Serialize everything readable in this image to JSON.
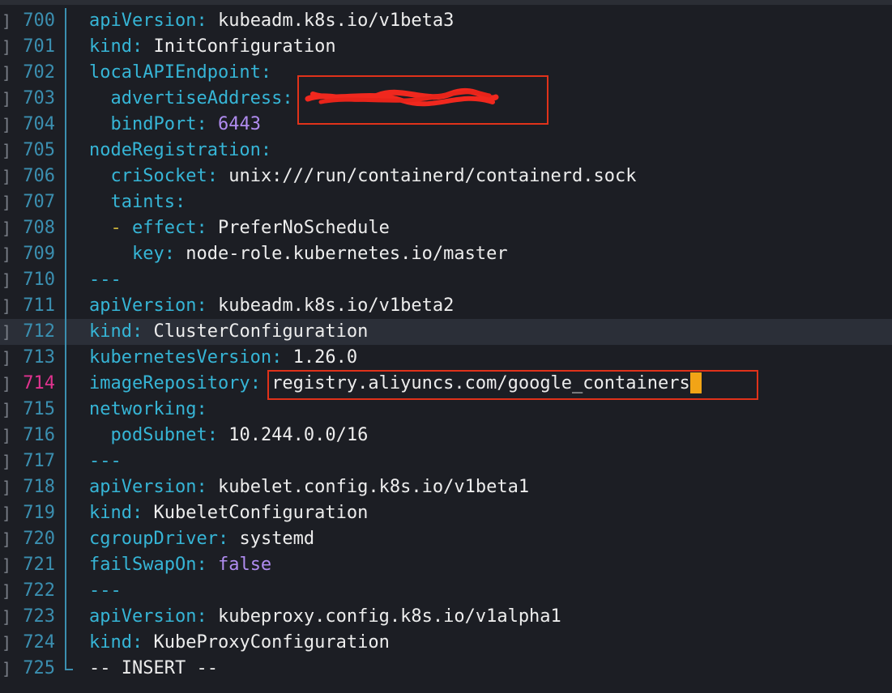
{
  "editor": {
    "mode_status": "-- INSERT --",
    "lines": [
      {
        "num": "700",
        "segments": [
          {
            "t": "apiVersion",
            "c": "key"
          },
          {
            "t": ": ",
            "c": "sep"
          },
          {
            "t": "kubeadm.k8s.io/v1beta3",
            "c": "val"
          }
        ]
      },
      {
        "num": "701",
        "segments": [
          {
            "t": "kind",
            "c": "key"
          },
          {
            "t": ": ",
            "c": "sep"
          },
          {
            "t": "InitConfiguration",
            "c": "val"
          }
        ]
      },
      {
        "num": "702",
        "segments": [
          {
            "t": "localAPIEndpoint",
            "c": "key"
          },
          {
            "t": ":",
            "c": "sep"
          }
        ]
      },
      {
        "num": "703",
        "segments": [
          {
            "t": "  advertiseAddress",
            "c": "key"
          },
          {
            "t": ": ",
            "c": "sep"
          }
        ]
      },
      {
        "num": "704",
        "segments": [
          {
            "t": "  bindPort",
            "c": "key"
          },
          {
            "t": ": ",
            "c": "sep"
          },
          {
            "t": "6443",
            "c": "num"
          }
        ]
      },
      {
        "num": "705",
        "segments": [
          {
            "t": "nodeRegistration",
            "c": "key"
          },
          {
            "t": ":",
            "c": "sep"
          }
        ]
      },
      {
        "num": "706",
        "segments": [
          {
            "t": "  criSocket",
            "c": "key"
          },
          {
            "t": ": ",
            "c": "sep"
          },
          {
            "t": "unix:///run/containerd/containerd.sock",
            "c": "val"
          }
        ]
      },
      {
        "num": "707",
        "segments": [
          {
            "t": "  taints",
            "c": "key"
          },
          {
            "t": ":",
            "c": "sep"
          }
        ]
      },
      {
        "num": "708",
        "segments": [
          {
            "t": "  - ",
            "c": "dash"
          },
          {
            "t": "effect",
            "c": "key"
          },
          {
            "t": ": ",
            "c": "sep"
          },
          {
            "t": "PreferNoSchedule",
            "c": "val"
          }
        ]
      },
      {
        "num": "709",
        "segments": [
          {
            "t": "    key",
            "c": "key"
          },
          {
            "t": ": ",
            "c": "sep"
          },
          {
            "t": "node-role.kubernetes.io/master",
            "c": "val"
          }
        ]
      },
      {
        "num": "710",
        "segments": [
          {
            "t": "---",
            "c": "key"
          }
        ]
      },
      {
        "num": "711",
        "segments": [
          {
            "t": "apiVersion",
            "c": "key"
          },
          {
            "t": ": ",
            "c": "sep"
          },
          {
            "t": "kubeadm.k8s.io/v1beta2",
            "c": "val"
          }
        ]
      },
      {
        "num": "712",
        "current": true,
        "segments": [
          {
            "t": "kind",
            "c": "key"
          },
          {
            "t": ": ",
            "c": "sep"
          },
          {
            "t": "ClusterConfiguration",
            "c": "val"
          }
        ]
      },
      {
        "num": "713",
        "segments": [
          {
            "t": "kubernetesVersion",
            "c": "key"
          },
          {
            "t": ": ",
            "c": "sep"
          },
          {
            "t": "1.26.0",
            "c": "val"
          }
        ]
      },
      {
        "num": "714",
        "active": true,
        "cursor": true,
        "segments": [
          {
            "t": "imageRepository",
            "c": "key"
          },
          {
            "t": ": ",
            "c": "sep"
          },
          {
            "t": "registry.aliyuncs.com/google_containers",
            "c": "val"
          }
        ]
      },
      {
        "num": "715",
        "segments": [
          {
            "t": "networking",
            "c": "key"
          },
          {
            "t": ":",
            "c": "sep"
          }
        ]
      },
      {
        "num": "716",
        "segments": [
          {
            "t": "  podSubnet",
            "c": "key"
          },
          {
            "t": ": ",
            "c": "sep"
          },
          {
            "t": "10.244.0.0/16",
            "c": "val"
          }
        ]
      },
      {
        "num": "717",
        "segments": [
          {
            "t": "---",
            "c": "key"
          }
        ]
      },
      {
        "num": "718",
        "segments": [
          {
            "t": "apiVersion",
            "c": "key"
          },
          {
            "t": ": ",
            "c": "sep"
          },
          {
            "t": "kubelet.config.k8s.io/v1beta1",
            "c": "val"
          }
        ]
      },
      {
        "num": "719",
        "segments": [
          {
            "t": "kind",
            "c": "key"
          },
          {
            "t": ": ",
            "c": "sep"
          },
          {
            "t": "KubeletConfiguration",
            "c": "val"
          }
        ]
      },
      {
        "num": "720",
        "segments": [
          {
            "t": "cgroupDriver",
            "c": "key"
          },
          {
            "t": ": ",
            "c": "sep"
          },
          {
            "t": "systemd",
            "c": "val"
          }
        ]
      },
      {
        "num": "721",
        "segments": [
          {
            "t": "failSwapOn",
            "c": "key"
          },
          {
            "t": ": ",
            "c": "sep"
          },
          {
            "t": "false",
            "c": "num"
          }
        ]
      },
      {
        "num": "722",
        "segments": [
          {
            "t": "---",
            "c": "key"
          }
        ]
      },
      {
        "num": "723",
        "segments": [
          {
            "t": "apiVersion",
            "c": "key"
          },
          {
            "t": ": ",
            "c": "sep"
          },
          {
            "t": "kubeproxy.config.k8s.io/v1alpha1",
            "c": "val"
          }
        ]
      },
      {
        "num": "724",
        "segments": [
          {
            "t": "kind",
            "c": "key"
          },
          {
            "t": ": ",
            "c": "sep"
          },
          {
            "t": "KubeProxyConfiguration",
            "c": "val"
          }
        ]
      },
      {
        "num": "725",
        "last": true,
        "segments": [
          {
            "t": "-- INSERT --",
            "c": "val"
          }
        ]
      }
    ]
  },
  "colors": {
    "background": "#1c1e24",
    "key": "#36b5d6",
    "value": "#ededed",
    "number": "#b08cf0",
    "line_number": "#3b8fb0",
    "active_line_number": "#e0338f",
    "cursor": "#f2a416",
    "highlight_box": "#e0321a",
    "redaction_scribble": "#f0281e"
  }
}
